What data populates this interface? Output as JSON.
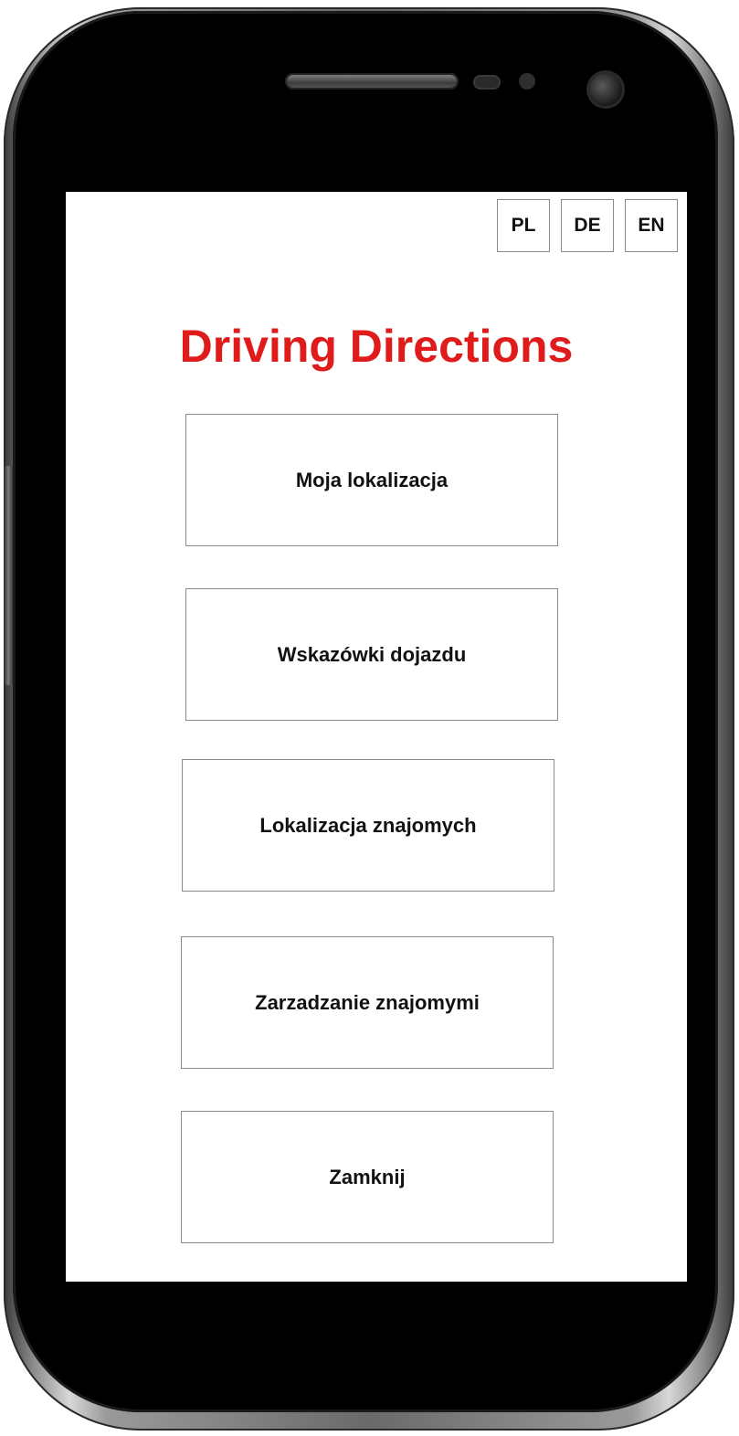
{
  "app": {
    "title": "Driving Directions"
  },
  "language_selector": {
    "options": [
      "PL",
      "DE",
      "EN"
    ]
  },
  "menu": {
    "items": [
      {
        "label": "Moja lokalizacja"
      },
      {
        "label": "Wskazówki dojazdu"
      },
      {
        "label": "Lokalizacja znajomych"
      },
      {
        "label": "Zarzadzanie znajomymi"
      },
      {
        "label": "Zamknij"
      }
    ]
  },
  "colors": {
    "title": "#e01b1b",
    "button_border": "#8a8a8a",
    "screen_background": "#ffffff",
    "device_body": "#000000"
  }
}
